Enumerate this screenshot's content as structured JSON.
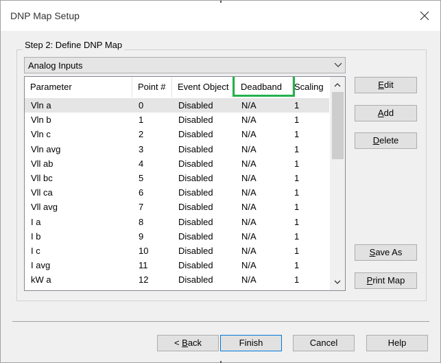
{
  "window": {
    "title": "DNP Map Setup"
  },
  "group": {
    "label": "Step 2: Define DNP Map"
  },
  "combo": {
    "value": "Analog Inputs"
  },
  "columns": [
    "Parameter",
    "Point #",
    "Event Object",
    "Deadband",
    "Scaling"
  ],
  "rows": [
    [
      "Vln a",
      "0",
      "Disabled",
      "N/A",
      "1"
    ],
    [
      "Vln b",
      "1",
      "Disabled",
      "N/A",
      "1"
    ],
    [
      "Vln c",
      "2",
      "Disabled",
      "N/A",
      "1"
    ],
    [
      "Vln avg",
      "3",
      "Disabled",
      "N/A",
      "1"
    ],
    [
      "Vll ab",
      "4",
      "Disabled",
      "N/A",
      "1"
    ],
    [
      "Vll bc",
      "5",
      "Disabled",
      "N/A",
      "1"
    ],
    [
      "Vll ca",
      "6",
      "Disabled",
      "N/A",
      "1"
    ],
    [
      "Vll avg",
      "7",
      "Disabled",
      "N/A",
      "1"
    ],
    [
      "I a",
      "8",
      "Disabled",
      "N/A",
      "1"
    ],
    [
      "I b",
      "9",
      "Disabled",
      "N/A",
      "1"
    ],
    [
      "I c",
      "10",
      "Disabled",
      "N/A",
      "1"
    ],
    [
      "I avg",
      "11",
      "Disabled",
      "N/A",
      "1"
    ],
    [
      "kW a",
      "12",
      "Disabled",
      "N/A",
      "1"
    ]
  ],
  "side_buttons": {
    "edit": {
      "key": "E",
      "rest": "dit"
    },
    "add": {
      "key": "A",
      "rest": "dd"
    },
    "delete": {
      "key": "D",
      "rest": "elete"
    },
    "save_as": {
      "key": "S",
      "rest": "ave As"
    },
    "print_map": {
      "key": "P",
      "rest": "rint Map"
    }
  },
  "footer_buttons": {
    "back": {
      "prefix": "< ",
      "key": "B",
      "rest": "ack"
    },
    "finish": "Finish",
    "cancel": "Cancel",
    "help": "Help"
  },
  "highlight_color": "#22b14c"
}
